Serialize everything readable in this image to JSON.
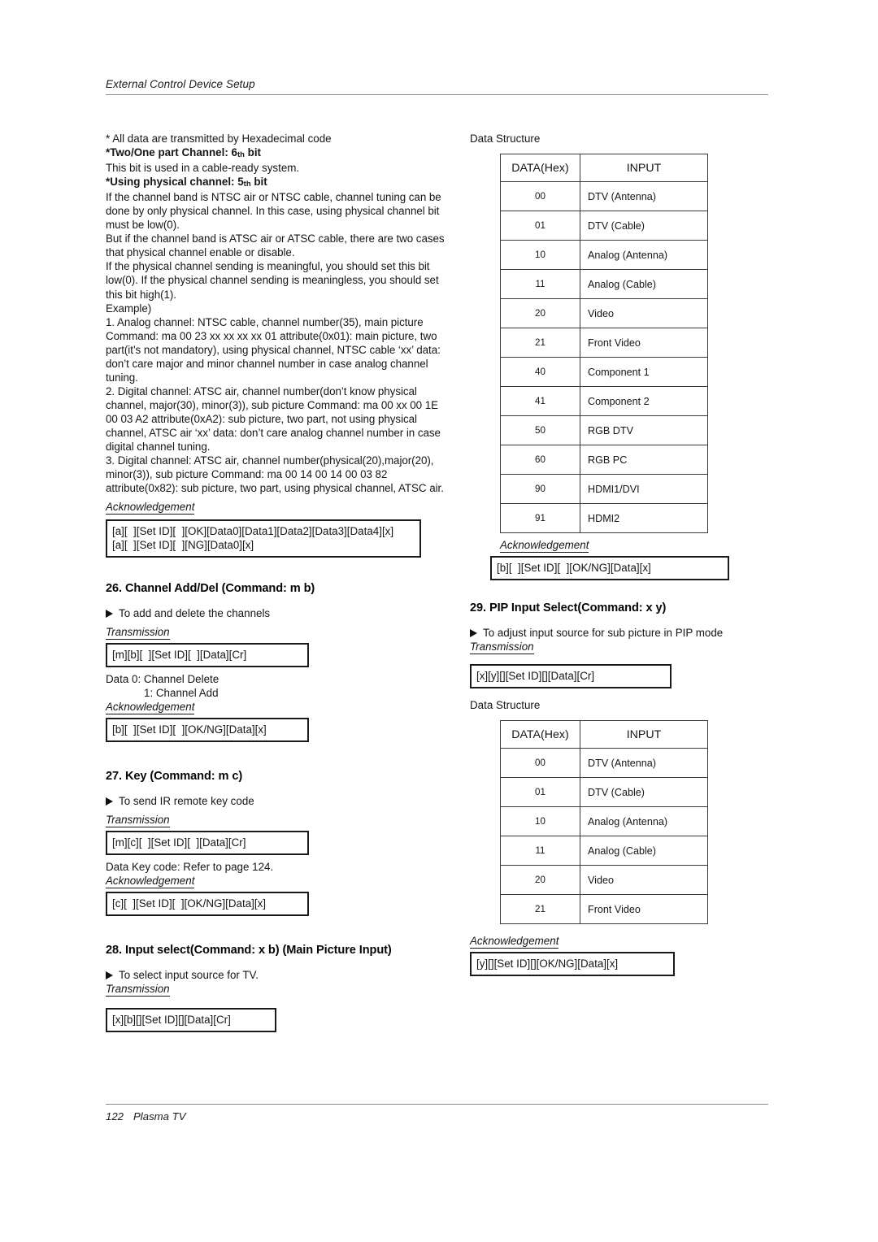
{
  "header": {
    "title": "External Control Device Setup"
  },
  "footer": {
    "page_number": "122",
    "label": "Plasma TV"
  },
  "left_column": {
    "note_all_data": "* All data are transmitted by Hexadecimal code",
    "bold_two_one_part": "*Two/One part Channel: 6",
    "bold_two_one_part_sup": "th",
    "bold_two_one_part_tail": " bit",
    "line_cable_ready": "This bit is used in a cable-ready system.",
    "bold_using_physical": "*Using physical channel: 5",
    "bold_using_physical_sup": "th",
    "bold_using_physical_tail": " bit",
    "paragraph_ntsc": "If the channel band is NTSC air or NTSC cable, channel tuning can be done by only physical channel. In this case, using physical channel bit must be low(0).",
    "paragraph_atsc": "But if the channel band is ATSC air or ATSC cable, there are two cases that physical channel enable or disable.",
    "paragraph_meaningful": "If the physical channel sending is meaningful, you should set this bit low(0). If the physical channel sending is meaningless, you should set this bit high(1).",
    "example_label": "Example)",
    "example_1": "1. Analog channel: NTSC cable, channel number(35), main picture Command: ma 00 23 xx xx xx xx 01 attribute(0x01): main picture, two part(it’s not mandatory), using physical channel, NTSC cable ‘xx’ data: don’t care major and minor channel number in case analog channel tuning.",
    "example_2": "2. Digital channel: ATSC air, channel number(don’t know physical channel, major(30), minor(3)), sub picture Command: ma 00 xx 00 1E 00 03 A2 attribute(0xA2): sub picture, two part, not using physical channel, ATSC air ‘xx’ data: don’t care analog channel number in case digital channel tuning.",
    "example_3": "3. Digital channel: ATSC air, channel number(physical(20),major(20), minor(3)), sub picture Command: ma 00 14 00 14 00 03 82 attribute(0x82): sub picture, two part, using physical channel, ATSC air.",
    "ack_label": "Acknowledgement",
    "ack_box_line1": "[a][  ][Set ID][  ][OK][Data0][Data1][Data2][Data3][Data4][x]",
    "ack_box_line2": "[a][  ][Set ID][  ][NG][Data0][x]",
    "section26": {
      "heading": "26. Channel Add/Del (Command: m b)",
      "bullet": "To add and delete the channels",
      "transmission_label": "Transmission",
      "transmission_box": "[m][b][  ][Set ID][  ][Data][Cr]",
      "data_line1": "Data  0: Channel Delete",
      "data_line2": "1: Channel Add",
      "ack_label": "Acknowledgement",
      "ack_box": "[b][  ][Set ID][  ][OK/NG][Data][x]"
    },
    "section27": {
      "heading": "27. Key (Command: m c)",
      "bullet": "To send IR remote key code",
      "transmission_label": "Transmission",
      "transmission_box": "[m][c][  ][Set ID][  ][Data][Cr]",
      "data_line": "Data  Key code: Refer to page 124.",
      "ack_label": "Acknowledgement",
      "ack_box": "[c][  ][Set ID][  ][OK/NG][Data][x]"
    },
    "section28": {
      "heading": "28. Input select(Command: x b) (Main Picture Input)",
      "bullet": "To select input source for TV.",
      "transmission_label": "Transmission",
      "transmission_box": "[x][b][][Set ID][][Data][Cr]"
    }
  },
  "right_column": {
    "data_structure_label_1": "Data Structure",
    "table1": {
      "headers": [
        "DATA(Hex)",
        "INPUT"
      ],
      "rows": [
        [
          "00",
          "DTV (Antenna)"
        ],
        [
          "01",
          "DTV (Cable)"
        ],
        [
          "10",
          "Analog (Antenna)"
        ],
        [
          "11",
          "Analog (Cable)"
        ],
        [
          "20",
          "Video"
        ],
        [
          "21",
          "Front Video"
        ],
        [
          "40",
          "Component 1"
        ],
        [
          "41",
          "Component 2"
        ],
        [
          "50",
          "RGB DTV"
        ],
        [
          "60",
          "RGB PC"
        ],
        [
          "90",
          "HDMI1/DVI"
        ],
        [
          "91",
          "HDMI2"
        ]
      ]
    },
    "ack_label_1": "Acknowledgement",
    "ack_box_1": "[b][  ][Set ID][  ][OK/NG][Data][x]",
    "section29": {
      "heading": "29. PIP Input Select(Command: x y)",
      "bullet": "To adjust input source for sub picture in PIP mode",
      "transmission_label": "Transmission",
      "transmission_box": "[x][y][][Set ID][][Data][Cr]",
      "data_structure_label": "Data Structure",
      "table": {
        "headers": [
          "DATA(Hex)",
          "INPUT"
        ],
        "rows": [
          [
            "00",
            "DTV (Antenna)"
          ],
          [
            "01",
            "DTV (Cable)"
          ],
          [
            "10",
            "Analog (Antenna)"
          ],
          [
            "11",
            "Analog (Cable)"
          ],
          [
            "20",
            "Video"
          ],
          [
            "21",
            "Front Video"
          ]
        ]
      },
      "ack_label": "Acknowledgement",
      "ack_box": "[y][][Set ID][][OK/NG][Data][x]"
    }
  }
}
